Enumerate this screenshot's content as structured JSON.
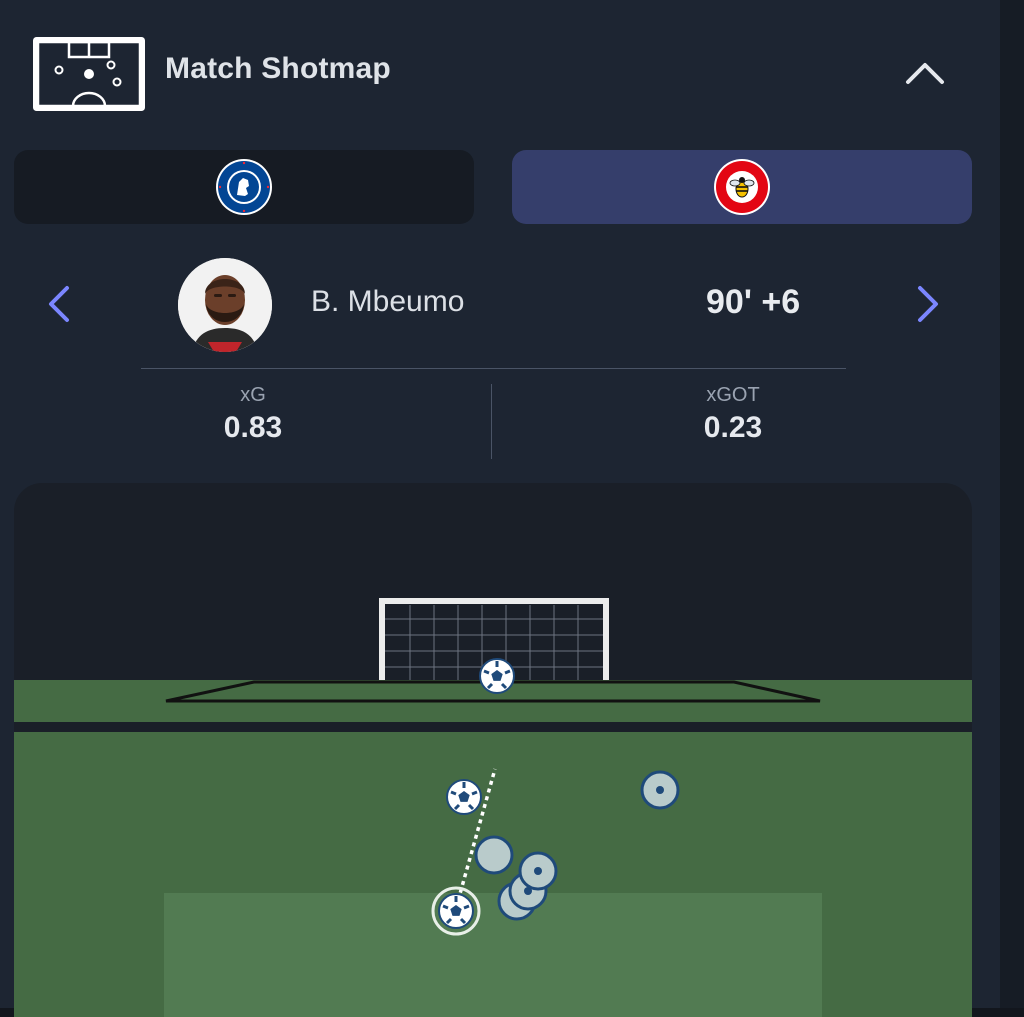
{
  "header": {
    "title": "Match Shotmap",
    "icon": "pitch-icon",
    "collapse_icon": "chevron-up-icon"
  },
  "teams": [
    {
      "name": "Chelsea",
      "crest_text": "CHELSEA",
      "crest_sub": "FOOTBALL CLUB",
      "selected": false,
      "color": "#034694"
    },
    {
      "name": "Brentford",
      "crest_text": "BRENTFORD",
      "crest_sub": "FOOTBALL CLUB",
      "selected": true,
      "color": "#e30613"
    }
  ],
  "shot": {
    "player_name": "B. Mbeumo",
    "minute": "90' +6",
    "stats": [
      {
        "label": "xG",
        "value": "0.83"
      },
      {
        "label": "xGOT",
        "value": "0.23"
      }
    ]
  },
  "colors": {
    "background": "#1d2532",
    "selected_tab": "#353e6b",
    "nav_arrow": "#7b86ff",
    "pitch_green": "#456b44",
    "box_green": "#527b52",
    "shot_fill": "#b9cbcb",
    "shot_stroke": "#1f4a7a"
  },
  "shotmap": {
    "outcomes_legend_note": "",
    "shots": [
      {
        "outcome": "goal",
        "selected": true
      },
      {
        "outcome": "goal",
        "selected": false
      },
      {
        "outcome": "saved",
        "selected": false
      },
      {
        "outcome": "saved",
        "selected": false
      },
      {
        "outcome": "missed",
        "selected": false
      },
      {
        "outcome": "missed",
        "selected": false
      },
      {
        "outcome": "blocked",
        "selected": false
      }
    ]
  }
}
